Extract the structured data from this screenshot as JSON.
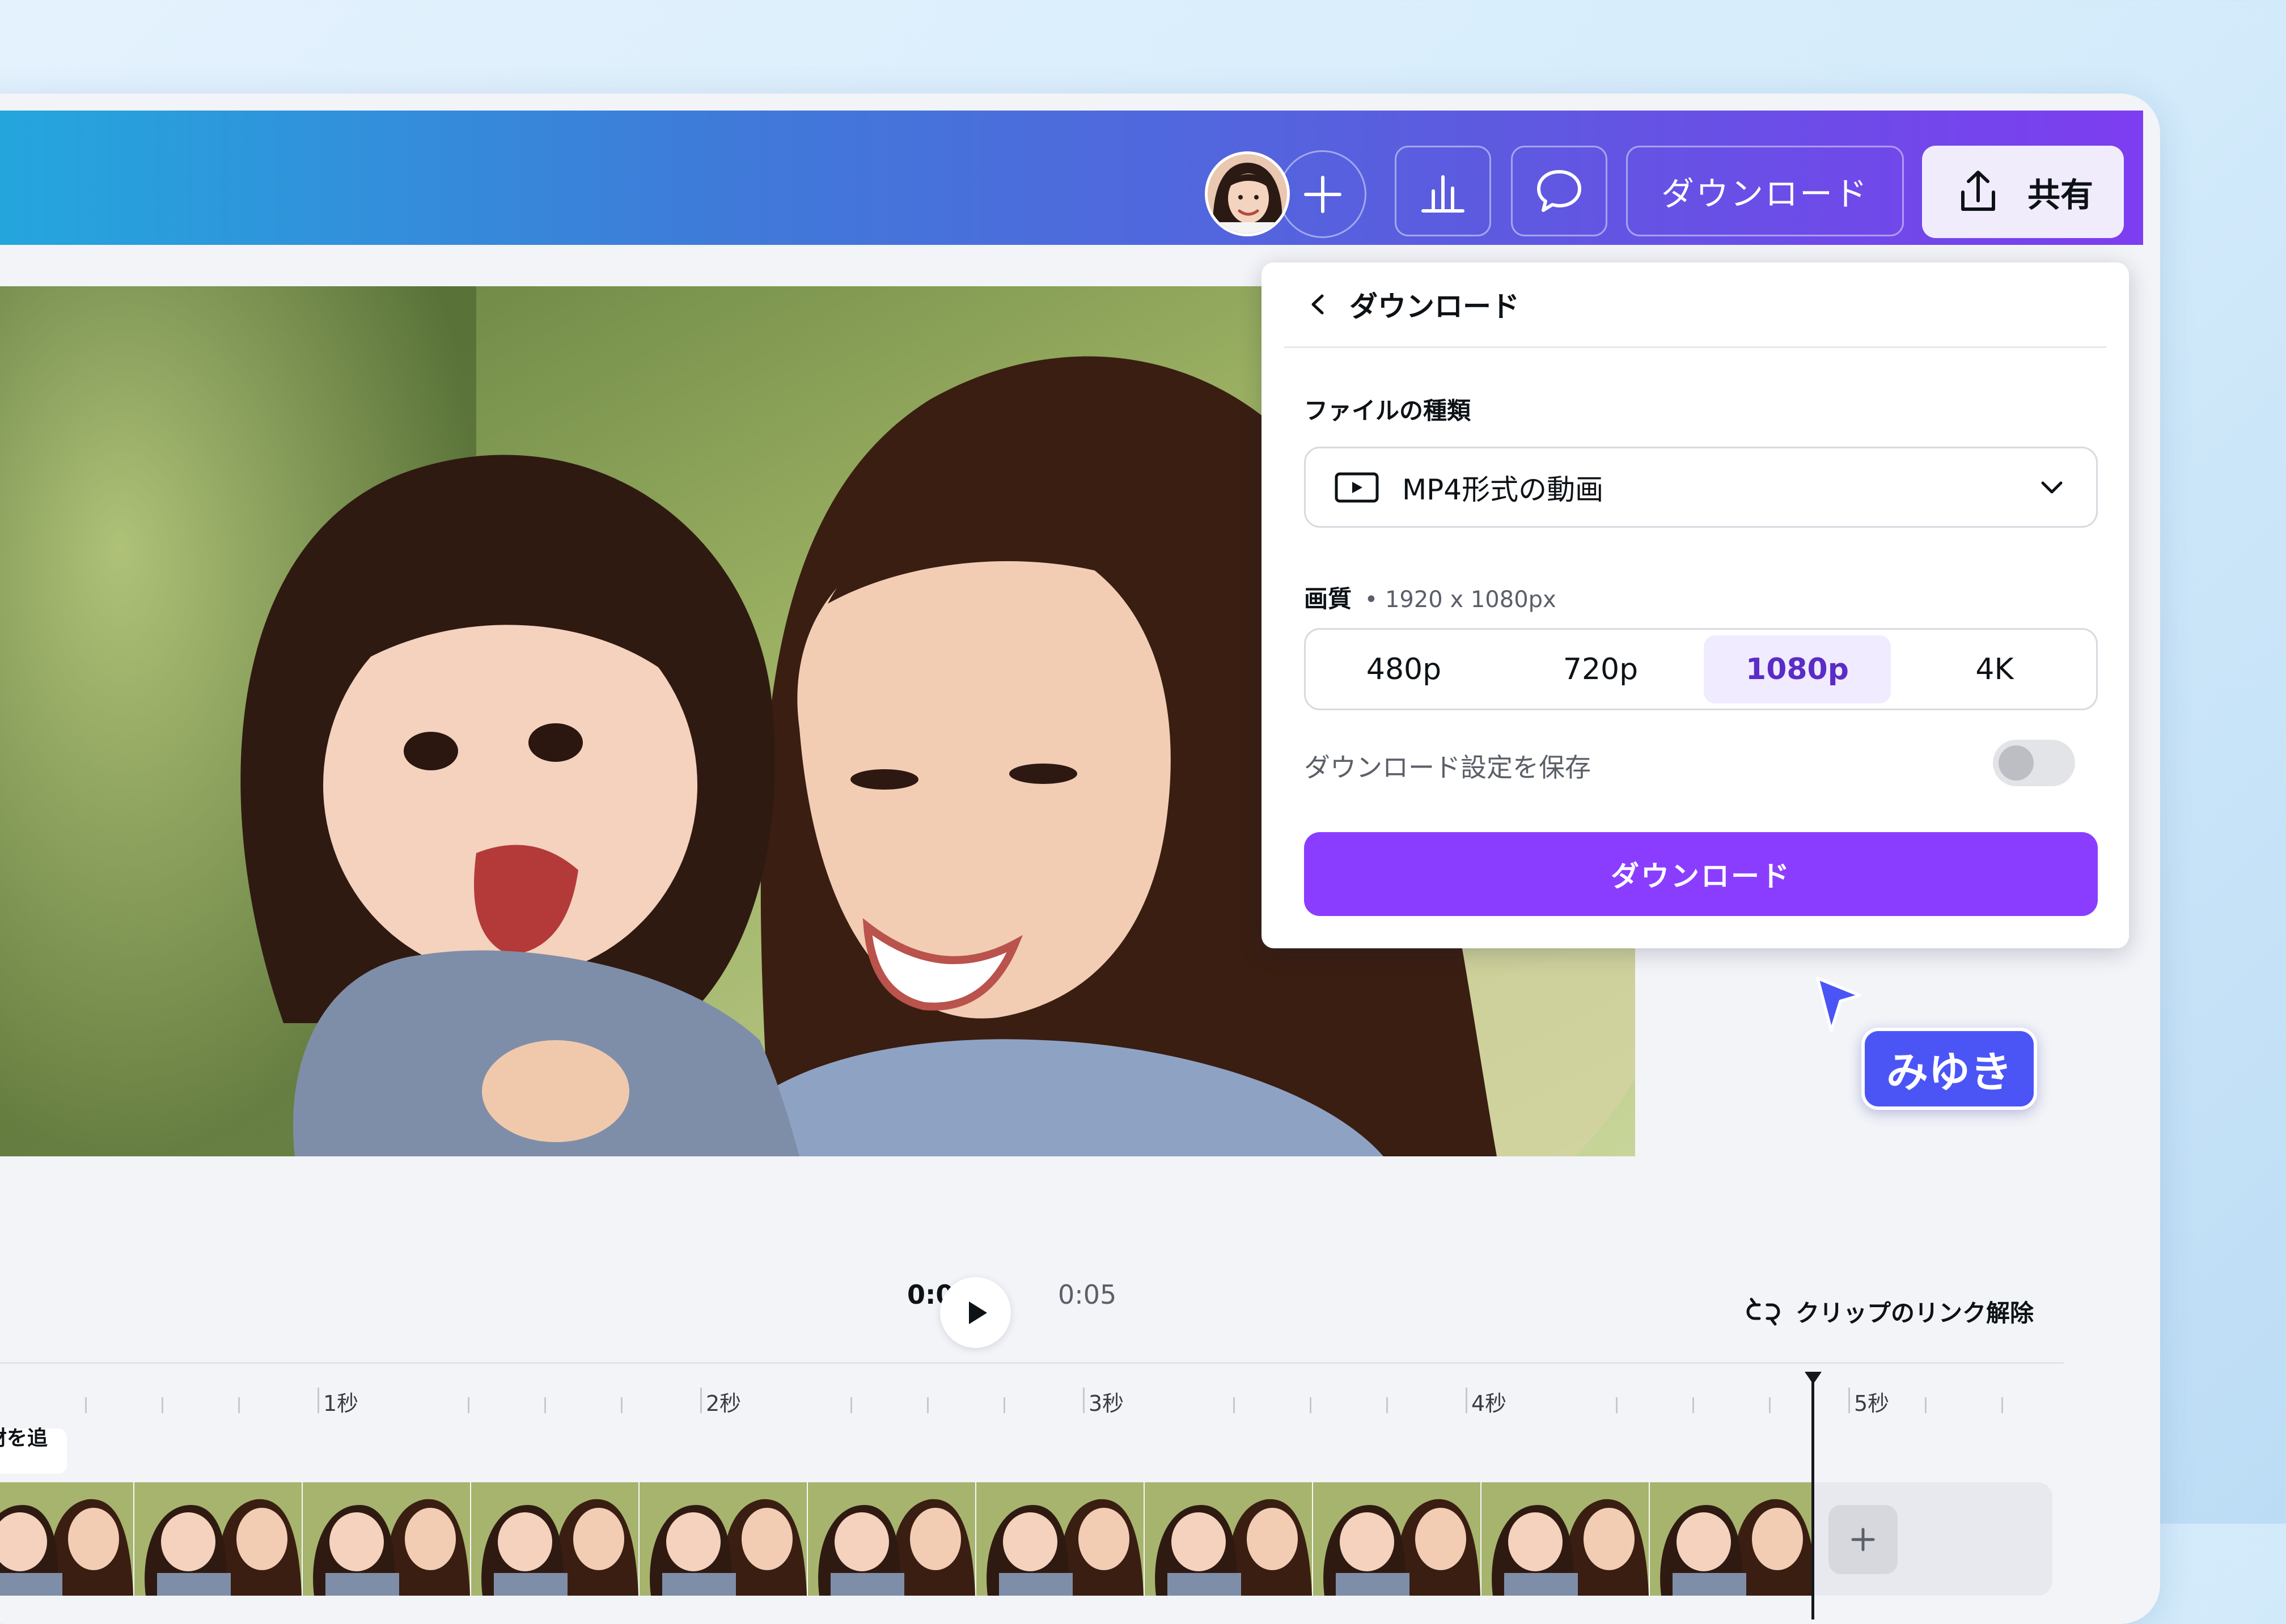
{
  "toolbar": {
    "download_label": "ダウンロード",
    "share_label": "共有"
  },
  "download_panel": {
    "title": "ダウンロード",
    "file_type_label": "ファイルの種類",
    "file_type_value": "MP4形式の動画",
    "quality_label": "画質",
    "quality_detail": "• 1920 x 1080px",
    "quality_options": [
      "480p",
      "720p",
      "1080p",
      "4K"
    ],
    "quality_selected": "1080p",
    "save_settings_label": "ダウンロード設定を保存",
    "save_settings_on": false,
    "download_button": "ダウンロード"
  },
  "collaborator": {
    "name": "みゆき",
    "cursor_color": "#4b55f6"
  },
  "playback": {
    "current_time": "0:04",
    "total_time": "0:05",
    "unlink_label": "クリップのリンク解除"
  },
  "timeline": {
    "add_media_label": "素材を追加",
    "seconds": [
      "1秒",
      "2秒",
      "3秒",
      "4秒",
      "5秒"
    ]
  },
  "colors": {
    "accent": "#8b3dff",
    "topbar_start": "#23a8dd",
    "topbar_end": "#7d3df0"
  }
}
